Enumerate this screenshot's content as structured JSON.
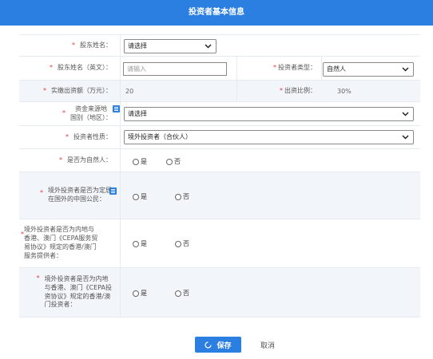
{
  "header": {
    "title": "投资者基本信息"
  },
  "form": {
    "shareholder_name": {
      "label": "股东姓名：",
      "selected": "请选择"
    },
    "shareholder_name_en": {
      "label": "股东姓名（英文）：",
      "placeholder": "请输入"
    },
    "investor_type": {
      "label": "投资者类型：",
      "selected": "自然人"
    },
    "capital": {
      "label": "实缴出资额（万元）：",
      "value": "20"
    },
    "ratio": {
      "label": "出资比例：",
      "value": "30%"
    },
    "fund_source": {
      "label_line1": "资金来源地",
      "label_line2": "国别（地区）：",
      "selected": "请选择"
    },
    "investor_nature": {
      "label": "投资者性质：",
      "selected": "境外投资者（合伙人）"
    },
    "is_natural_person": {
      "label": "是否为自然人：",
      "yes": "是",
      "no": "否"
    },
    "overseas_citizen": {
      "label_line1": "境外投资者是否为定居",
      "label_line2": "在国外的中国公民：",
      "yes": "是",
      "no": "否"
    },
    "cepa_trade": {
      "label_line1": "境外投资者是否为内地与",
      "label_line2": "香港、澳门《CEPA服务贸",
      "label_line3": "易协议》规定的香港/澳门",
      "label_line4": "服务提供者：",
      "yes": "是",
      "no": "否"
    },
    "cepa_invest": {
      "label_line1": "境外投资者是否为内地",
      "label_line2": "与香港、澳门《CEPA投",
      "label_line3": "资协议》规定的香港/澳",
      "label_line4": "门投资者：",
      "yes": "是",
      "no": "否"
    },
    "required_mark": "*"
  },
  "actions": {
    "save": "保存",
    "cancel": "取消"
  },
  "colors": {
    "primary": "#2b7fe0",
    "required": "#e33b3b",
    "alt_row": "#f2f5f9",
    "border": "#e6ebf0"
  },
  "icons": {
    "dropdown": "chevron-down-icon",
    "info": "info-list-icon",
    "save": "loading-icon"
  }
}
